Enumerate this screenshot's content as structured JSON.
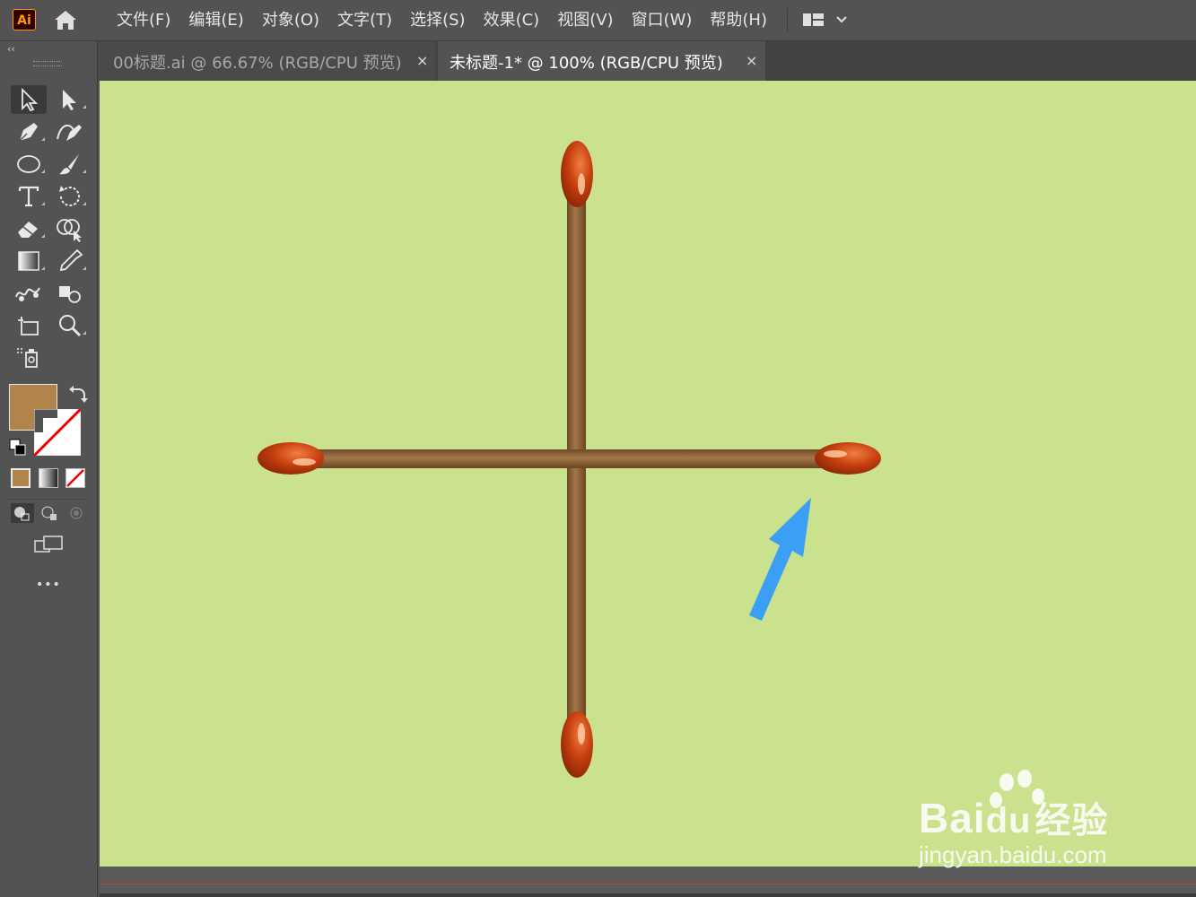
{
  "app": {
    "logo": "Ai"
  },
  "menu": [
    "文件(F)",
    "编辑(E)",
    "对象(O)",
    "文字(T)",
    "选择(S)",
    "效果(C)",
    "视图(V)",
    "窗口(W)",
    "帮助(H)"
  ],
  "tabs": [
    {
      "label": "00标题.ai @ 66.67% (RGB/CPU 预览)",
      "close": "×",
      "active": false
    },
    {
      "label": "未标题-1* @ 100% (RGB/CPU 预览)",
      "close": "×",
      "active": true
    }
  ],
  "toolbar": {
    "collapse": "‹‹",
    "more": "•••"
  },
  "colors": {
    "fill": "#b0844b",
    "canvas": "#cae18d",
    "match_head": "#c8400f",
    "match_stick": "#8b6238",
    "arrow": "#3b9ff5"
  },
  "watermark": {
    "brand": "Bai",
    "brand2": "经验",
    "url": "jingyan.baidu.com"
  }
}
